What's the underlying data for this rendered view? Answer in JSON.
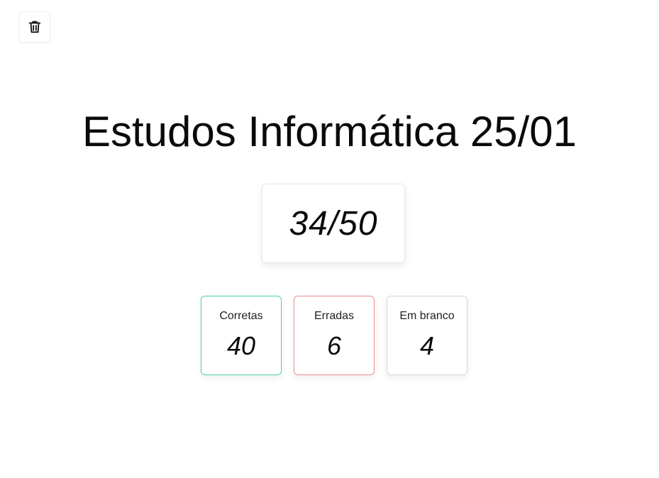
{
  "toolbar": {
    "delete_icon": "trash-icon"
  },
  "page": {
    "title": "Estudos Informática 25/01"
  },
  "score": {
    "text": "34/50"
  },
  "stats": [
    {
      "label": "Corretas",
      "value": "40",
      "color": "#4fd1a5"
    },
    {
      "label": "Erradas",
      "value": "6",
      "color": "#f08c8c"
    },
    {
      "label": "Em branco",
      "value": "4",
      "color": "#d6d6d6"
    }
  ]
}
